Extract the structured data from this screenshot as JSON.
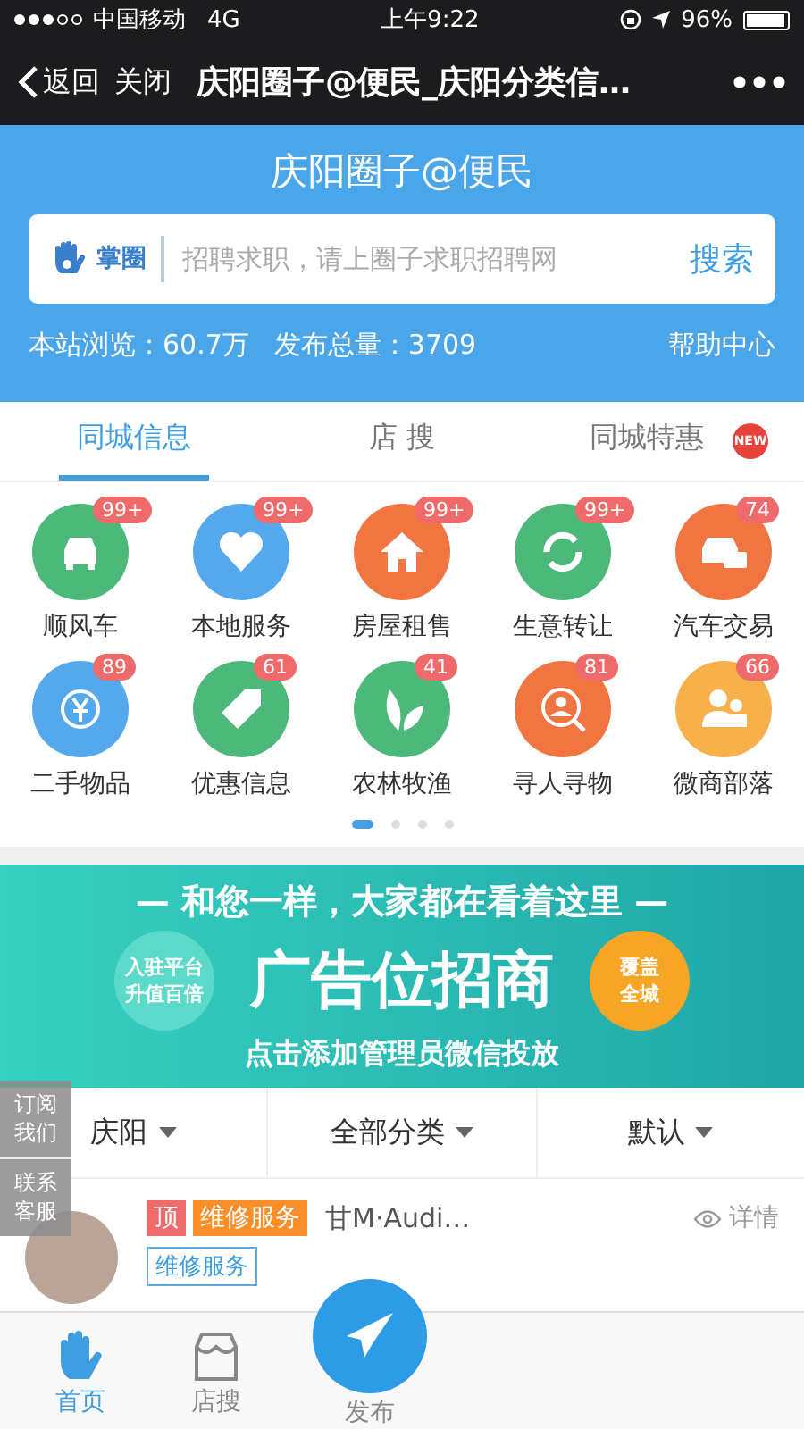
{
  "status_bar": {
    "carrier": "中国移动",
    "network": "4G",
    "time": "上午9:22",
    "battery": "96%"
  },
  "nav_bar": {
    "back": "返回",
    "close": "关闭",
    "title": "庆阳圈子@便民_庆阳分类信…"
  },
  "header": {
    "title": "庆阳圈子@便民",
    "logo_text": "掌圈",
    "search": {
      "placeholder": "招聘求职，请上圈子求职招聘网",
      "button": "搜索"
    },
    "views": "本站浏览：60.7万",
    "posts": "发布总量：3709",
    "help": "帮助中心"
  },
  "tabs": [
    {
      "label": "同城信息",
      "selected": true
    },
    {
      "label": "店 搜",
      "selected": false
    },
    {
      "label": "同城特惠",
      "selected": false,
      "badge": "NEW"
    }
  ],
  "categories": [
    {
      "label": "顺风车",
      "count": "99+",
      "color": "#4cb87a"
    },
    {
      "label": "本地服务",
      "count": "99+",
      "color": "#55a8ec"
    },
    {
      "label": "房屋租售",
      "count": "99+",
      "color": "#f07541"
    },
    {
      "label": "生意转让",
      "count": "99+",
      "color": "#4cb87a"
    },
    {
      "label": "汽车交易",
      "count": "74",
      "color": "#f07541"
    },
    {
      "label": "二手物品",
      "count": "89",
      "color": "#55a8ec"
    },
    {
      "label": "优惠信息",
      "count": "61",
      "color": "#4cb87a"
    },
    {
      "label": "农林牧渔",
      "count": "41",
      "color": "#4cb87a"
    },
    {
      "label": "寻人寻物",
      "count": "81",
      "color": "#f07541"
    },
    {
      "label": "微商部落",
      "count": "66",
      "color": "#f8b04a"
    }
  ],
  "page_dots": [
    {
      "selected": true
    },
    {
      "selected": false
    },
    {
      "selected": false
    },
    {
      "selected": false
    }
  ],
  "banner": {
    "slogan": "— 和您一样，大家都在看着这里 —",
    "headline": "广告位招商",
    "left_badge": [
      "入驻平台",
      "升值百倍"
    ],
    "right_badge": [
      "覆盖",
      "全城"
    ],
    "footer": "点击添加管理员微信投放"
  },
  "filters": [
    {
      "label": "庆阳"
    },
    {
      "label": "全部分类"
    },
    {
      "label": "默认"
    }
  ],
  "side_tabs": [
    {
      "label": "订阅我们"
    },
    {
      "label": "联系客服"
    }
  ],
  "post": {
    "top_tag": "顶",
    "category_tag": "维修服务",
    "author": "甘M·Audi…",
    "detail": "详情",
    "outline_tag": "维修服务"
  },
  "bottom_nav": [
    {
      "label": "首页",
      "selected": true
    },
    {
      "label": "店搜",
      "selected": false
    },
    {
      "label": "发布",
      "kind": "publish"
    }
  ]
}
